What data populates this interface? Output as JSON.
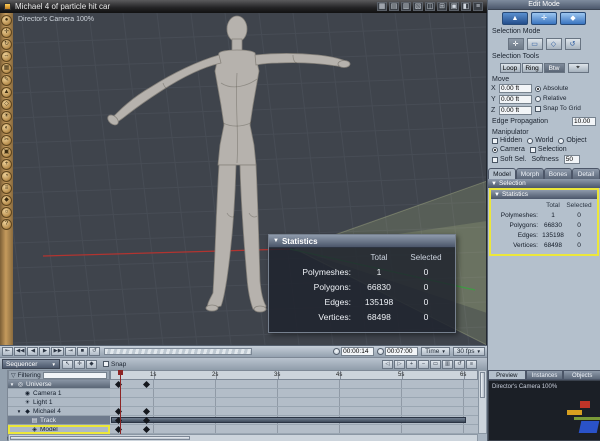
{
  "titlebar": {
    "title": "Michael 4 of particle hit car",
    "view_icons": [
      "▦",
      "▤",
      "▥",
      "▧",
      "◫",
      "⊞",
      "▣",
      "◧",
      "≡"
    ]
  },
  "left_toolbar": {
    "tools": [
      "●",
      "✛",
      "↻",
      "⇔",
      "▦",
      "✎",
      "▲",
      "◇",
      "☀",
      "◐",
      "✂",
      "▣",
      "+",
      "◔",
      "≡",
      "◆",
      "○",
      "?"
    ]
  },
  "viewport": {
    "camera_label": "Director's Camera 100%"
  },
  "stats": {
    "title": "Statistics",
    "total_header": "Total",
    "selected_header": "Selected",
    "rows": [
      {
        "label": "Polymeshes:",
        "total": "1",
        "selected": "0"
      },
      {
        "label": "Polygons:",
        "total": "66830",
        "selected": "0"
      },
      {
        "label": "Edges:",
        "total": "135198",
        "selected": "0"
      },
      {
        "label": "Vertices:",
        "total": "68498",
        "selected": "0"
      }
    ]
  },
  "right_panel": {
    "edit_mode_label": "Edit Mode",
    "selection_mode_label": "Selection Mode",
    "selection_tools_label": "Selection Tools",
    "selection_tool_buttons": [
      "Loop",
      "Ring",
      "Btw"
    ],
    "axes": [
      {
        "axis": "X",
        "value": "0.00 ft"
      },
      {
        "axis": "Y",
        "value": "0.00 ft"
      },
      {
        "axis": "Z",
        "value": "0.00 ft"
      }
    ],
    "move_label": "Move",
    "absolute_label": "Absolute",
    "relative_label": "Relative",
    "snap_to_grid_label": "Snap To Grid",
    "edge_propagation_label": "Edge Propagation",
    "edge_propagation_value": "10.00",
    "manipulator_label": "Manipulator",
    "hidden_label": "Hidden",
    "world_label": "World",
    "object_label": "Object",
    "camera_label": "Camera",
    "selection_label": "Selection",
    "soft_sel_label": "Soft Sel.",
    "softness_label": "Softness",
    "softness_value": "50",
    "tabs": [
      "Model",
      "Morph",
      "Bones",
      "Detail"
    ],
    "selection_section_label": "Selection",
    "statistics_section_label": "Statistics"
  },
  "preview_panel": {
    "tabs": [
      "Preview",
      "Instances",
      "Objects"
    ],
    "camera_label": "Director's Camera 100%"
  },
  "transport": {
    "buttons": [
      "⇤",
      "◀◀",
      "◀",
      "▶",
      "▶▶",
      "⇥",
      "■",
      "↺"
    ],
    "time_current": "00:00:14",
    "time_total": "00:07:00",
    "time_mode": "Time",
    "fps": "30 fps"
  },
  "sequencer": {
    "menu_label": "Sequencer",
    "vertical_tab": "Sequencer",
    "snap_label": "Snap",
    "filtering_label": "Filtering",
    "icons_left": [
      "↖",
      "✛",
      "◆"
    ],
    "icons_right": [
      "◁",
      "▷",
      "+",
      "−",
      "▭",
      "▥",
      "↺",
      "≡"
    ],
    "ruler_labels": [
      "1s",
      "2s",
      "3s",
      "4s",
      "5s",
      "6s"
    ],
    "tracks": [
      {
        "label": "Universe",
        "indent": 0,
        "expanded": true,
        "icon": "◎",
        "icon_name": "universe-icon",
        "keys": [
          0.4,
          0.85
        ]
      },
      {
        "label": "Camera 1",
        "indent": 1,
        "icon": "◉",
        "icon_name": "camera-icon",
        "keys": []
      },
      {
        "label": "Light 1",
        "indent": 1,
        "icon": "☀",
        "icon_name": "light-icon",
        "keys": []
      },
      {
        "label": "Michael 4",
        "indent": 1,
        "expanded": true,
        "icon": "◆",
        "icon_name": "figure-icon",
        "keys": [
          0.4,
          0.85
        ]
      },
      {
        "label": "Track",
        "indent": 2,
        "dark": true,
        "icon": "▤",
        "icon_name": "track-icon",
        "keys": [
          0.4,
          0.85
        ],
        "bar": [
          0.33,
          6.05
        ]
      },
      {
        "label": "Model",
        "indent": 2,
        "selected": true,
        "icon": "◈",
        "icon_name": "model-icon",
        "keys": [
          0.4,
          0.85
        ]
      }
    ]
  }
}
